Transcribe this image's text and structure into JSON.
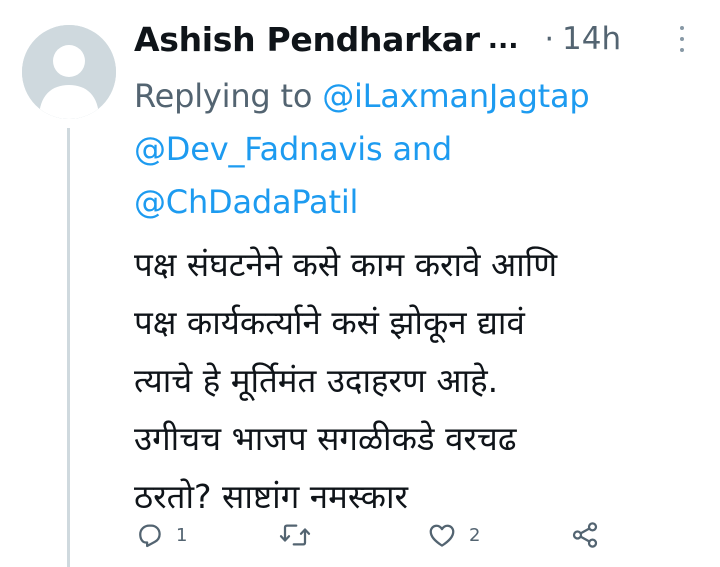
{
  "tweet": {
    "author": "Ashish Pendharkar",
    "ellipsis": "...",
    "separator": "·",
    "time": "14h",
    "reply_prefix": "Replying to ",
    "mention1": "@iLaxmanJagtap",
    "mention2": "@Dev_Fadnavis",
    "and_text": "and",
    "mention3": "@ChDadaPatil",
    "lines": [
      "पक्ष संघटनेने कसे काम करावे आणि",
      "पक्ष कार्यकर्त्याने कसं झोकून द्यावं",
      "त्याचे हे मूर्तिमंत उदाहरण आहे.",
      "उगीचच भाजप सगळीकडे वरचढ",
      "ठरतो? साष्टांग नमस्कार"
    ]
  },
  "actions": {
    "reply_count": "1",
    "retweet_count": "",
    "like_count": "2"
  },
  "colors": {
    "link": "#1d9bf0",
    "secondary_text": "#536471",
    "primary_text": "#0f1419",
    "avatar_bg": "#cfd9de"
  },
  "icons": [
    "default-avatar-icon",
    "more-options-icon",
    "reply-icon",
    "retweet-icon",
    "like-icon",
    "share-icon"
  ]
}
